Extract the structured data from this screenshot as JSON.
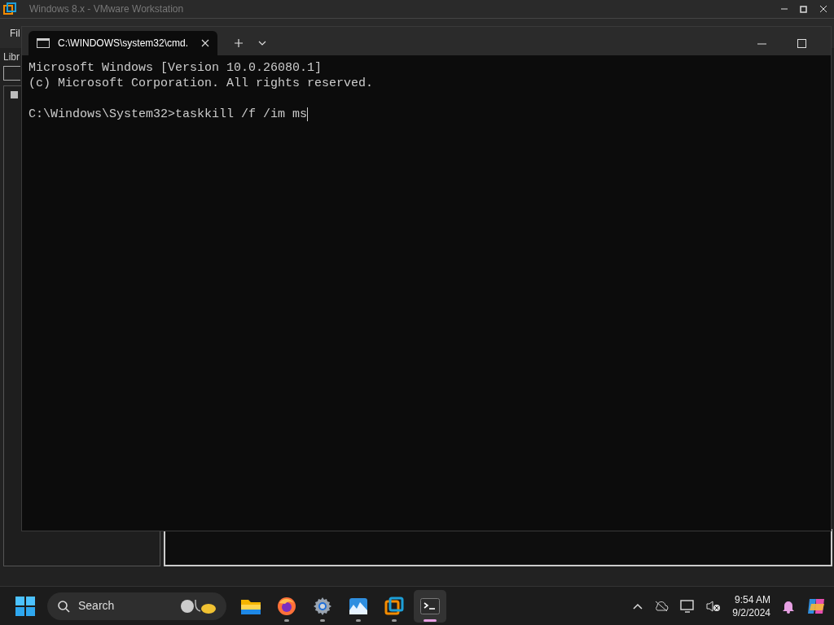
{
  "vmware": {
    "title": "Windows 8.x - VMware Workstation",
    "menu_item": "Fil",
    "library_label": "Libr"
  },
  "terminal": {
    "tabs": [
      {
        "title": "C:\\WINDOWS\\system32\\cmd.",
        "selected": true
      }
    ],
    "output": [
      "Microsoft Windows [Version 10.0.26080.1]",
      "(c) Microsoft Corporation. All rights reserved."
    ],
    "prompt": "C:\\Windows\\System32>taskkill /f /im ms"
  },
  "taskbar": {
    "search": {
      "placeholder": "Search"
    },
    "apps": [
      {
        "kind": "folder",
        "running": false,
        "selected": false
      },
      {
        "kind": "browser",
        "running": true,
        "selected": false
      },
      {
        "kind": "settings",
        "running": true,
        "selected": false
      },
      {
        "kind": "photos",
        "running": true,
        "selected": false
      },
      {
        "kind": "vmware",
        "running": true,
        "selected": false
      },
      {
        "kind": "terminal",
        "running": true,
        "selected": true
      }
    ],
    "time": "9:54 AM",
    "date": "9/2/2024"
  }
}
